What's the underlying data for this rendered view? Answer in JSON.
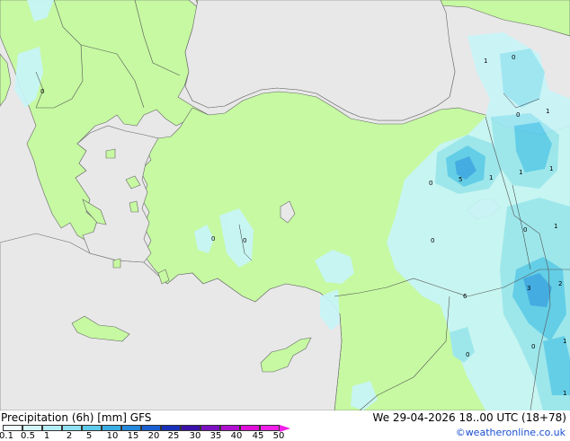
{
  "map": {
    "colors": {
      "sea": "#e8e8e8",
      "land": "#c6f9a2",
      "precip_light": "#c8f5f8",
      "precip_medium": "#9ae6f2",
      "precip_heavy": "#5ccbec",
      "precip_strong": "#3aa6e6"
    },
    "contour_labels": [
      "0",
      "1",
      "0",
      "0",
      "1",
      "0",
      "5",
      "1",
      "1",
      "1",
      "0",
      "0",
      "0",
      "1",
      "0",
      "6",
      "3",
      "2",
      "0",
      "1",
      "0",
      "1"
    ]
  },
  "footer": {
    "title": "Precipitation (6h) [mm] GFS",
    "date": "We 29-04-2026 18..00 UTC (18+78)",
    "credit": "©weatheronline.co.uk"
  },
  "legend": {
    "labels": [
      "0.1",
      "0.5",
      "1",
      "2",
      "5",
      "10",
      "15",
      "20",
      "25",
      "30",
      "35",
      "40",
      "45",
      "50"
    ],
    "colors": [
      "#f0fcfe",
      "#d2f6fa",
      "#b4eef7",
      "#8ee2f2",
      "#5ccbec",
      "#38aee4",
      "#2488dc",
      "#1a5fd0",
      "#1830b8",
      "#3a10a8",
      "#7a10c0",
      "#b010d0",
      "#e010d8",
      "#f020e8"
    ]
  }
}
